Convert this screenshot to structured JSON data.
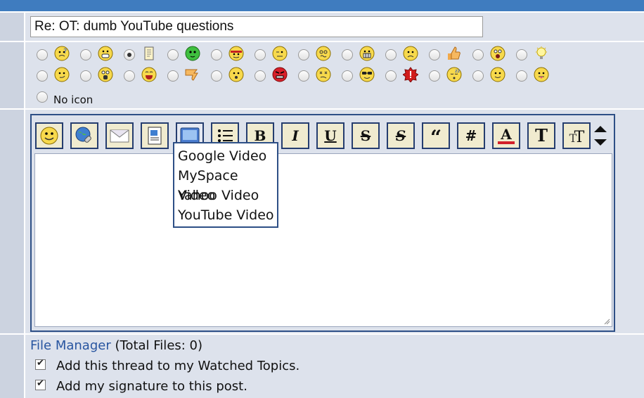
{
  "subject": {
    "value": "Re: OT: dumb YouTube questions"
  },
  "post_icons": {
    "row1": [
      "confused-icon",
      "grin-icon",
      "document-icon",
      "alien-icon",
      "cool-icon",
      "wink-icon",
      "crazy-icon",
      "teeth-icon",
      "frown-icon",
      "thumbs-up-icon",
      "shocked-icon",
      "lightbulb-icon"
    ],
    "row2": [
      "smirk-icon",
      "eek-icon",
      "laugh-icon",
      "thumbs-down-icon",
      "surprised-icon",
      "mad-icon",
      "dizzy-icon",
      "sunglasses-icon",
      "exclamation-icon",
      "sleepy-icon",
      "smile-icon",
      "tongue-icon"
    ],
    "selected": "document-icon",
    "no_icon_label": "No icon"
  },
  "toolbar": {
    "buttons": [
      "smilies",
      "insert-link",
      "insert-email",
      "insert-image",
      "insert-video",
      "list",
      "bold",
      "italic",
      "underline",
      "strikethrough",
      "strike-alt",
      "quote",
      "code",
      "text-color",
      "font",
      "font-size",
      "resize"
    ]
  },
  "video_menu": {
    "items": [
      "Google Video",
      "MySpace Video",
      "Yahoo Video",
      "YouTube Video"
    ]
  },
  "options": {
    "file_manager_link": "File Manager",
    "file_manager_count": "(Total Files: 0)",
    "watch_label": "Add this thread to my Watched Topics.",
    "signature_label": "Add my signature to this post."
  },
  "colors": {
    "topbar": "#3f7cbf",
    "frame": "#2d4f86",
    "background": "#dde2ec"
  }
}
